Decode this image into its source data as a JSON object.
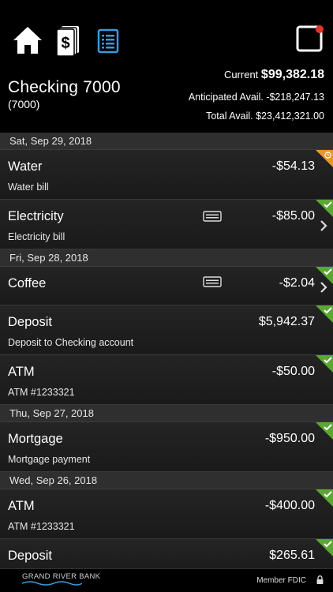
{
  "nav": {
    "home_icon": "home-icon",
    "statement_icon": "dollar-statement-icon",
    "register_icon": "register-list-icon",
    "notification_icon": "notification-icon"
  },
  "account": {
    "name": "Checking 7000",
    "number": "(7000)",
    "current_label": "Current",
    "current_value": "$99,382.18",
    "anticipated_label": "Anticipated Avail.",
    "anticipated_value": "-$218,247.13",
    "total_label": "Total Avail.",
    "total_value": "$23,412,321.00"
  },
  "groups": [
    {
      "date": "Sat, Sep 29, 2018",
      "transactions": [
        {
          "title": "Water",
          "amount": "-$54.13",
          "desc": "Water bill",
          "status": "pending"
        },
        {
          "title": "Electricity",
          "amount": "-$85.00",
          "desc": "Electricity bill",
          "status": "cleared",
          "memo": true,
          "chevron": true
        }
      ]
    },
    {
      "date": "Fri, Sep 28, 2018",
      "transactions": [
        {
          "title": "Coffee",
          "amount": "-$2.04",
          "desc": "",
          "status": "cleared",
          "memo": true,
          "chevron": true
        },
        {
          "title": "Deposit",
          "amount": "$5,942.37",
          "desc": "Deposit to Checking account",
          "status": "cleared"
        },
        {
          "title": "ATM",
          "amount": "-$50.00",
          "desc": "ATM #1233321",
          "status": "cleared"
        }
      ]
    },
    {
      "date": "Thu, Sep 27, 2018",
      "transactions": [
        {
          "title": "Mortgage",
          "amount": "-$950.00",
          "desc": "Mortgage payment",
          "status": "cleared"
        }
      ]
    },
    {
      "date": "Wed, Sep 26, 2018",
      "transactions": [
        {
          "title": "ATM",
          "amount": "-$400.00",
          "desc": "ATM #1233321",
          "status": "cleared"
        },
        {
          "title": "Deposit",
          "amount": "$265.61",
          "desc": "",
          "status": "cleared"
        }
      ]
    }
  ],
  "footer": {
    "bank_name": "GRAND RIVER BANK",
    "fdic": "Member FDIC"
  },
  "colors": {
    "cleared": "#5aa832",
    "pending": "#e8962a",
    "accent": "#3a9ad9",
    "notification": "#e8322c"
  }
}
